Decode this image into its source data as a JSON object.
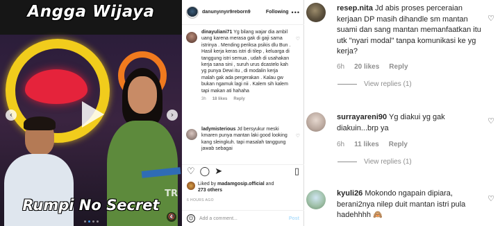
{
  "media": {
    "top_title": "Angga Wijaya",
    "bottom_title": "Rumpi No Secret",
    "channel_logo": "TR",
    "prev_arrow": "‹",
    "next_arrow": "›",
    "mute_glyph": "🔇"
  },
  "post": {
    "username": "danunyinyir9reborn9",
    "follow_label": "Following",
    "more_glyph": "•••",
    "comments": [
      {
        "username": "dinayuliani71",
        "text": "Yg bilang wajar dia ambil uang karena merasa gak di gaji sama istrinya . Mending periksa psikis dlu Bun . Hasil kerja keras istri di tilep , keluarga di tanggung istri semua , udah di usahakan kerja sana sini , suruh urus dcastelo kah yg punya Dewi itu , di modalin kerja malah gak ada pergerakan . Kalau gw bukan ngamuk lagi nii . Kalem sih kalem tapi makan ati hahaha",
        "time": "3h",
        "likes": "18 likes",
        "reply": "Reply"
      },
      {
        "username": "ladymisterious",
        "text": "Jd bersyukur meski kmaren punya mantan laki good looking kang sleingkuh. tapi masalah tanggung jawab sebagai"
      }
    ],
    "liked_by_prefix": "Liked by ",
    "liked_by_user": "madamgosip.official",
    "liked_by_and": " and",
    "liked_by_others": "273 others",
    "time_ago": "6 HOURS AGO",
    "add_comment_placeholder": "Add a comment...",
    "post_button": "Post",
    "emoji_glyph": "☺"
  },
  "zoom": {
    "comments": [
      {
        "username": "resep.nita",
        "text": "Jd abis proses perceraian kerjaan DP masih dihandle sm mantan suami dan sang mantan memanfaatkan itu utk \"nyari modal\" tanpa komunikasi ke yg kerja?",
        "time": "6h",
        "likes": "20 likes",
        "reply": "Reply",
        "view_replies": "View replies (1)"
      },
      {
        "username": "surrayareni90",
        "text": "Yg diakui yg gak diakuin...brp ya",
        "time": "6h",
        "likes": "11 likes",
        "reply": "Reply",
        "view_replies": "View replies (1)"
      },
      {
        "username": "kyuli26",
        "text": "Mokondo ngapain dipiara, berani2nya nilep duit mantan istri pula hadehhhh 🙈"
      }
    ]
  },
  "colors": {
    "link_blue": "#3897f0",
    "muted_gray": "#8e8e8e",
    "text_dark": "#262626"
  },
  "icons": [
    "heart-icon",
    "comment-icon",
    "share-icon",
    "bookmark-icon",
    "play-icon",
    "mute-icon",
    "emoji-icon",
    "more-icon"
  ]
}
